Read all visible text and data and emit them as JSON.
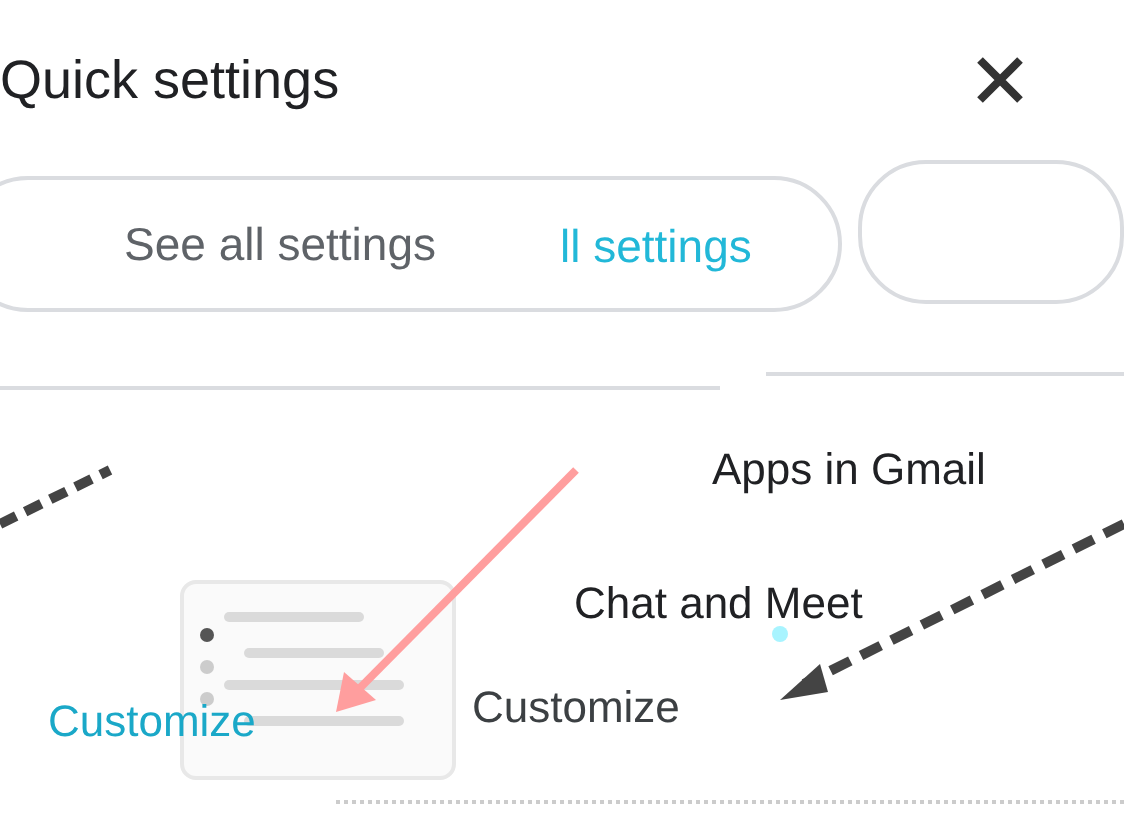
{
  "panel": {
    "title": "Quick settings"
  },
  "see_all_button": {
    "label": "See all settings",
    "ghost_label": "ll settings"
  },
  "items": [
    {
      "label": "Apps in Gmail"
    },
    {
      "label": "Chat and Meet"
    },
    {
      "label": "Customize"
    }
  ],
  "illustration": {
    "label": "Customize"
  }
}
